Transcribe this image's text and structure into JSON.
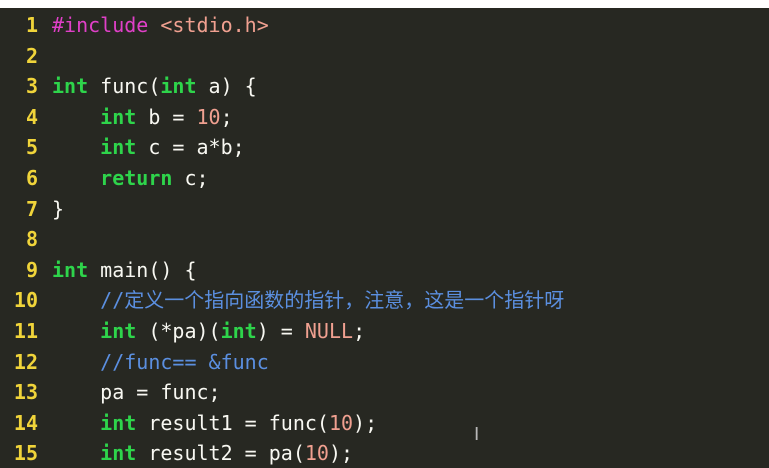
{
  "editor": {
    "lines": [
      {
        "n": "1",
        "tokens": [
          {
            "t": "#include",
            "c": "pp"
          },
          {
            "t": " ",
            "c": "id"
          },
          {
            "t": "<stdio.h>",
            "c": "str"
          }
        ]
      },
      {
        "n": "2",
        "tokens": []
      },
      {
        "n": "3",
        "tokens": [
          {
            "t": "int",
            "c": "kw"
          },
          {
            "t": " func(",
            "c": "id"
          },
          {
            "t": "int",
            "c": "kw"
          },
          {
            "t": " a) {",
            "c": "id"
          }
        ]
      },
      {
        "n": "4",
        "tokens": [
          {
            "t": "    ",
            "c": "id"
          },
          {
            "t": "int",
            "c": "kw"
          },
          {
            "t": " b = ",
            "c": "id"
          },
          {
            "t": "10",
            "c": "num"
          },
          {
            "t": ";",
            "c": "id"
          }
        ]
      },
      {
        "n": "5",
        "tokens": [
          {
            "t": "    ",
            "c": "id"
          },
          {
            "t": "int",
            "c": "kw"
          },
          {
            "t": " c = a*b;",
            "c": "id"
          }
        ]
      },
      {
        "n": "6",
        "tokens": [
          {
            "t": "    ",
            "c": "id"
          },
          {
            "t": "return",
            "c": "kw"
          },
          {
            "t": " c;",
            "c": "id"
          }
        ]
      },
      {
        "n": "7",
        "tokens": [
          {
            "t": "}",
            "c": "id"
          }
        ]
      },
      {
        "n": "8",
        "tokens": []
      },
      {
        "n": "9",
        "tokens": [
          {
            "t": "int",
            "c": "kw"
          },
          {
            "t": " main() {",
            "c": "id"
          }
        ]
      },
      {
        "n": "10",
        "tokens": [
          {
            "t": "    ",
            "c": "id"
          },
          {
            "t": "//定义一个指向函数的指针，注意，这是一个指针呀",
            "c": "cm"
          }
        ]
      },
      {
        "n": "11",
        "tokens": [
          {
            "t": "    ",
            "c": "id"
          },
          {
            "t": "int",
            "c": "kw"
          },
          {
            "t": " (*pa)(",
            "c": "id"
          },
          {
            "t": "int",
            "c": "kw"
          },
          {
            "t": ") = ",
            "c": "id"
          },
          {
            "t": "NULL",
            "c": "num"
          },
          {
            "t": ";",
            "c": "id"
          }
        ]
      },
      {
        "n": "12",
        "tokens": [
          {
            "t": "    ",
            "c": "id"
          },
          {
            "t": "//func== &func",
            "c": "cm"
          }
        ]
      },
      {
        "n": "13",
        "tokens": [
          {
            "t": "    pa = func;",
            "c": "id"
          }
        ]
      },
      {
        "n": "14",
        "tokens": [
          {
            "t": "    ",
            "c": "id"
          },
          {
            "t": "int",
            "c": "kw"
          },
          {
            "t": " result1 = func(",
            "c": "id"
          },
          {
            "t": "10",
            "c": "num"
          },
          {
            "t": ");",
            "c": "id"
          }
        ]
      },
      {
        "n": "15",
        "tokens": [
          {
            "t": "    ",
            "c": "id"
          },
          {
            "t": "int",
            "c": "kw"
          },
          {
            "t": " result2 = pa(",
            "c": "id"
          },
          {
            "t": "10",
            "c": "num"
          },
          {
            "t": ");",
            "c": "id"
          }
        ]
      }
    ],
    "cursor_glyph": "I",
    "colors": {
      "background": "#272822",
      "line_number": "#f0d43a",
      "keyword": "#2ed44b",
      "preprocessor": "#e040c8",
      "number": "#f0a090",
      "comment": "#5b8fe0",
      "text": "#f8f8f2"
    }
  }
}
